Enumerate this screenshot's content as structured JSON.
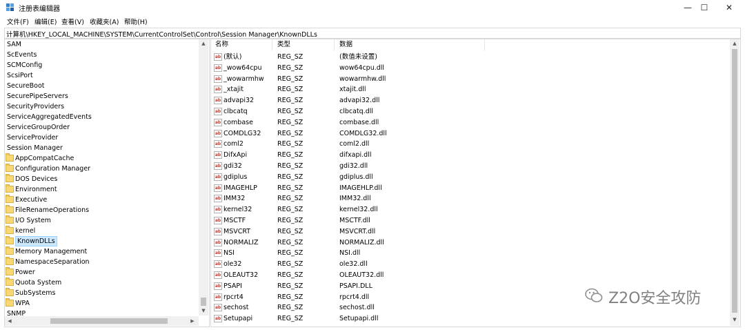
{
  "window": {
    "title": "注册表编辑器",
    "minimize_glyph": "—",
    "maximize_glyph": "☐",
    "close_glyph": "✕"
  },
  "menu": [
    "文件(F)",
    "编辑(E)",
    "查看(V)",
    "收藏夹(A)",
    "帮助(H)"
  ],
  "address": "计算机\\HKEY_LOCAL_MACHINE\\SYSTEM\\CurrentControlSet\\Control\\Session Manager\\KnownDLLs",
  "tree": {
    "top_items": [
      "SAM",
      "ScEvents",
      "SCMConfig",
      "ScsiPort",
      "SecureBoot",
      "SecurePipeServers",
      "SecurityProviders",
      "ServiceAggregatedEvents",
      "ServiceGroupOrder",
      "ServiceProvider",
      "Session Manager"
    ],
    "children": [
      "AppCompatCache",
      "Configuration Manager",
      "DOS Devices",
      "Environment",
      "Executive",
      "FileRenameOperations",
      "I/O System",
      "kernel",
      "KnownDLLs",
      "Memory Management",
      "NamespaceSeparation",
      "Power",
      "Quota System",
      "SubSystems",
      "WPA"
    ],
    "after_items": [
      "SNMP"
    ],
    "selected": "KnownDLLs"
  },
  "list": {
    "columns": [
      "名称",
      "类型",
      "数据"
    ],
    "rows": [
      [
        "(默认)",
        "REG_SZ",
        "(数值未设置)"
      ],
      [
        "_wow64cpu",
        "REG_SZ",
        "wow64cpu.dll"
      ],
      [
        "_wowarmhw",
        "REG_SZ",
        "wowarmhw.dll"
      ],
      [
        "_xtajit",
        "REG_SZ",
        "xtajit.dll"
      ],
      [
        "advapi32",
        "REG_SZ",
        "advapi32.dll"
      ],
      [
        "clbcatq",
        "REG_SZ",
        "clbcatq.dll"
      ],
      [
        "combase",
        "REG_SZ",
        "combase.dll"
      ],
      [
        "COMDLG32",
        "REG_SZ",
        "COMDLG32.dll"
      ],
      [
        "coml2",
        "REG_SZ",
        "coml2.dll"
      ],
      [
        "DifxApi",
        "REG_SZ",
        "difxapi.dll"
      ],
      [
        "gdi32",
        "REG_SZ",
        "gdi32.dll"
      ],
      [
        "gdiplus",
        "REG_SZ",
        "gdiplus.dll"
      ],
      [
        "IMAGEHLP",
        "REG_SZ",
        "IMAGEHLP.dll"
      ],
      [
        "IMM32",
        "REG_SZ",
        "IMM32.dll"
      ],
      [
        "kernel32",
        "REG_SZ",
        "kernel32.dll"
      ],
      [
        "MSCTF",
        "REG_SZ",
        "MSCTF.dll"
      ],
      [
        "MSVCRT",
        "REG_SZ",
        "MSVCRT.dll"
      ],
      [
        "NORMALIZ",
        "REG_SZ",
        "NORMALIZ.dll"
      ],
      [
        "NSI",
        "REG_SZ",
        "NSI.dll"
      ],
      [
        "ole32",
        "REG_SZ",
        "ole32.dll"
      ],
      [
        "OLEAUT32",
        "REG_SZ",
        "OLEAUT32.dll"
      ],
      [
        "PSAPI",
        "REG_SZ",
        "PSAPI.DLL"
      ],
      [
        "rpcrt4",
        "REG_SZ",
        "rpcrt4.dll"
      ],
      [
        "sechost",
        "REG_SZ",
        "sechost.dll"
      ],
      [
        "Setupapi",
        "REG_SZ",
        "Setupapi.dll"
      ]
    ]
  },
  "watermark": "Z2O安全攻防"
}
